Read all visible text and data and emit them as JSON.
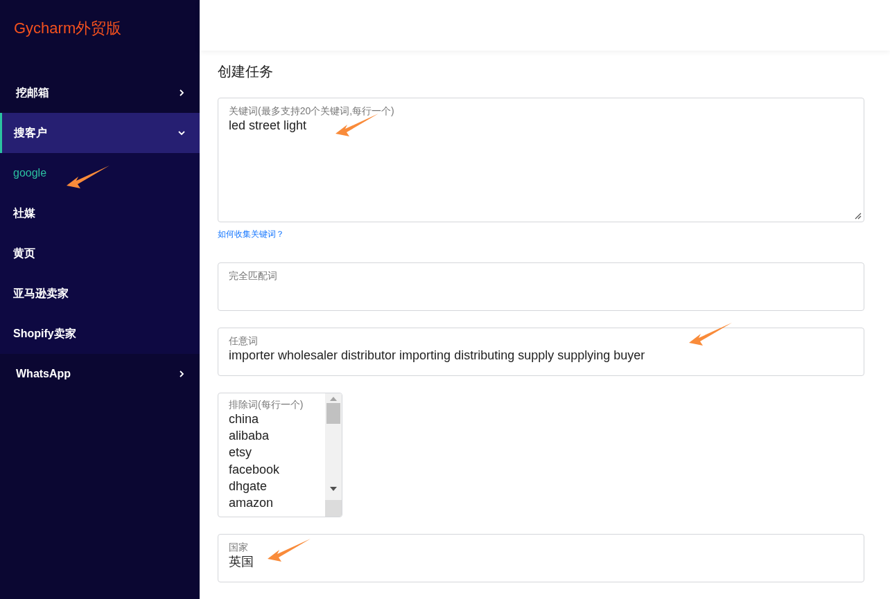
{
  "app": {
    "logo": "Gycharm外贸版"
  },
  "sidebar": {
    "items": [
      {
        "label": "挖邮箱",
        "expanded": false,
        "selected": false
      },
      {
        "label": "搜客户",
        "expanded": true,
        "selected": true,
        "children": [
          {
            "label": "google",
            "selected": true,
            "annotated": true
          },
          {
            "label": "社媒",
            "selected": false,
            "annotated": false
          },
          {
            "label": "黄页",
            "selected": false,
            "annotated": false
          },
          {
            "label": "亚马逊卖家",
            "selected": false,
            "annotated": false
          },
          {
            "label": "Shopify卖家",
            "selected": false,
            "annotated": false
          }
        ]
      },
      {
        "label": "WhatsApp",
        "expanded": false,
        "selected": false
      }
    ]
  },
  "page": {
    "title": "创建任务"
  },
  "form": {
    "fields": [
      {
        "kind": "textarea",
        "label": "关键词(最多支持20个关键词,每行一个)",
        "value": "led street light",
        "help_link": "如何收集关键词？",
        "annotated": true
      },
      {
        "kind": "input",
        "label": "完全匹配词",
        "annotated": false
      },
      {
        "kind": "input",
        "label": "任意词",
        "value": "importer wholesaler distributor importing distributing supply supplying buyer",
        "annotated": true
      },
      {
        "kind": "list",
        "label": "排除词(每行一个)",
        "lines": [
          "china",
          "alibaba",
          "etsy",
          "facebook",
          "dhgate",
          "amazon"
        ],
        "annotated": false
      },
      {
        "kind": "input",
        "label": "国家",
        "value": "英国",
        "annotated": true
      }
    ]
  }
}
